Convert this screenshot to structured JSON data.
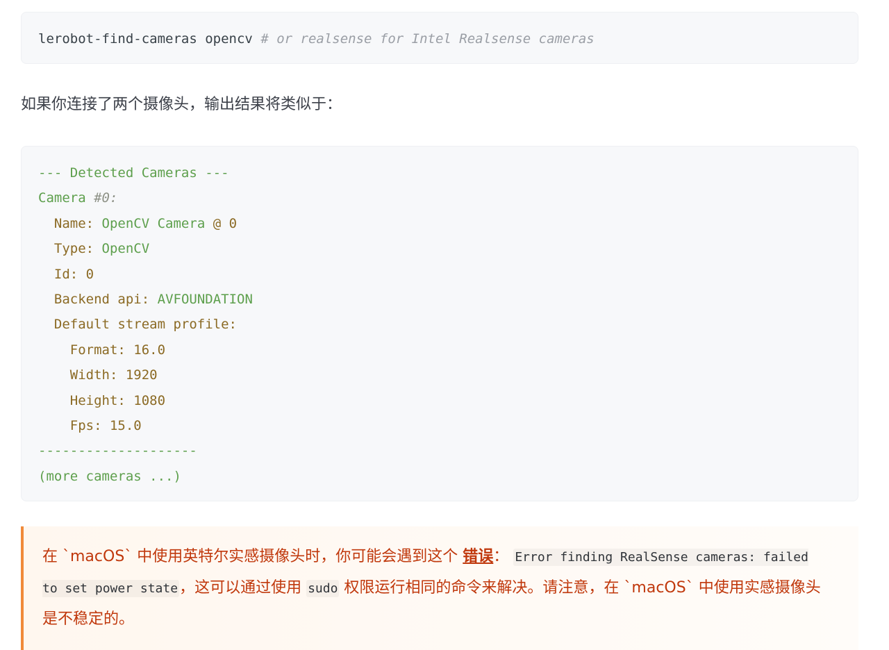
{
  "command_block": {
    "command": "lerobot-find-cameras opencv",
    "comment": "# or realsense for Intel Realsense cameras"
  },
  "intro_text": "如果你连接了两个摄像头，输出结果将类似于：",
  "output_block": {
    "lines": [
      {
        "indent": "",
        "key": "",
        "value": "--- Detected Cameras ---",
        "style": "header"
      },
      {
        "indent": "",
        "key": "Camera",
        "value": "#0:",
        "style": "camera"
      },
      {
        "indent": "  ",
        "key": "Name:",
        "value": "OpenCV Camera",
        "tail": "@ 0"
      },
      {
        "indent": "  ",
        "key": "Type:",
        "value": "OpenCV"
      },
      {
        "indent": "  ",
        "key": "Id: 0",
        "value": ""
      },
      {
        "indent": "  ",
        "key": "Backend api:",
        "value": "AVFOUNDATION"
      },
      {
        "indent": "  ",
        "key": "Default stream profile:",
        "value": ""
      },
      {
        "indent": "    ",
        "key": "Format: 16.0",
        "value": ""
      },
      {
        "indent": "    ",
        "key": "Width: 1920",
        "value": ""
      },
      {
        "indent": "    ",
        "key": "Height: 1080",
        "value": ""
      },
      {
        "indent": "    ",
        "key": "Fps: 15.0",
        "value": ""
      },
      {
        "indent": "",
        "key": "",
        "value": "--------------------",
        "style": "header"
      },
      {
        "indent": "",
        "key": "",
        "value": "(more cameras ...)",
        "style": "header"
      }
    ]
  },
  "warning_callout": {
    "text_before": "在 `macOS` 中使用英特尔实感摄像头时，你可能会遇到这个 ",
    "link_label": "错误",
    "colon": "：",
    "code_error": "Error finding RealSense cameras: failed to set power state",
    "text_middle": "，这可以通过使用 ",
    "code_sudo": "sudo",
    "text_after": " 权限运行相同的命令来解决。请注意，在 `macOS` 中使用实感摄像头是不稳定的。",
    "accent_color": "#f08a3a",
    "text_color": "#c0380c"
  }
}
